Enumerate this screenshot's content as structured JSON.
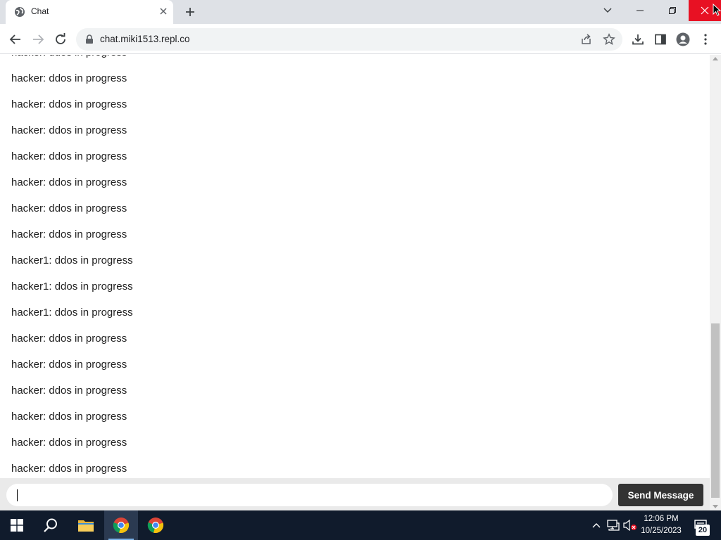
{
  "browser": {
    "tab_title": "Chat",
    "url": "chat.miki1513.repl.co"
  },
  "chat": {
    "messages": [
      "hacker: ddos in progress",
      "hacker: ddos in progress",
      "hacker: ddos in progress",
      "hacker: ddos in progress",
      "hacker: ddos in progress",
      "hacker: ddos in progress",
      "hacker: ddos in progress",
      "hacker: ddos in progress",
      "hacker1: ddos in progress",
      "hacker1: ddos in progress",
      "hacker1: ddos in progress",
      "hacker: ddos in progress",
      "hacker: ddos in progress",
      "hacker: ddos in progress",
      "hacker: ddos in progress",
      "hacker: ddos in progress",
      "hacker: ddos in progress"
    ],
    "input_value": "",
    "send_label": "Send Message"
  },
  "taskbar": {
    "time": "12:06 PM",
    "date": "10/25/2023",
    "notification_count": "20"
  },
  "colors": {
    "close_red": "#e81123",
    "send_button": "#333333",
    "taskbar": "#101b2c"
  }
}
